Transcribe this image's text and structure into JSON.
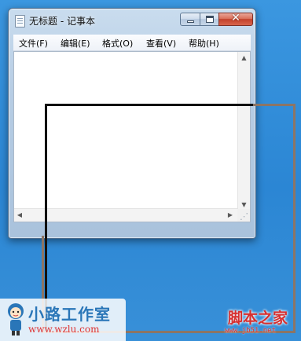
{
  "window": {
    "title": "无标题 - 记事本",
    "close_glyph": "✕"
  },
  "menu": {
    "file": "文件(F)",
    "edit": "编辑(E)",
    "format": "格式(O)",
    "view": "查看(V)",
    "help": "帮助(H)"
  },
  "editor": {
    "content": ""
  },
  "scroll": {
    "up": "▲",
    "down": "▼",
    "left": "◀",
    "right": "▶"
  },
  "watermark_left": {
    "title": "小路工作室",
    "url": "www.wzlu.com"
  },
  "watermark_right": {
    "title": "脚本之家",
    "url": "www.jb51.net"
  },
  "colors": {
    "desktop": "#2f8fd8",
    "close_button": "#c2412b",
    "overlay_black": "#111111",
    "overlay_brown": "#8c7565"
  }
}
